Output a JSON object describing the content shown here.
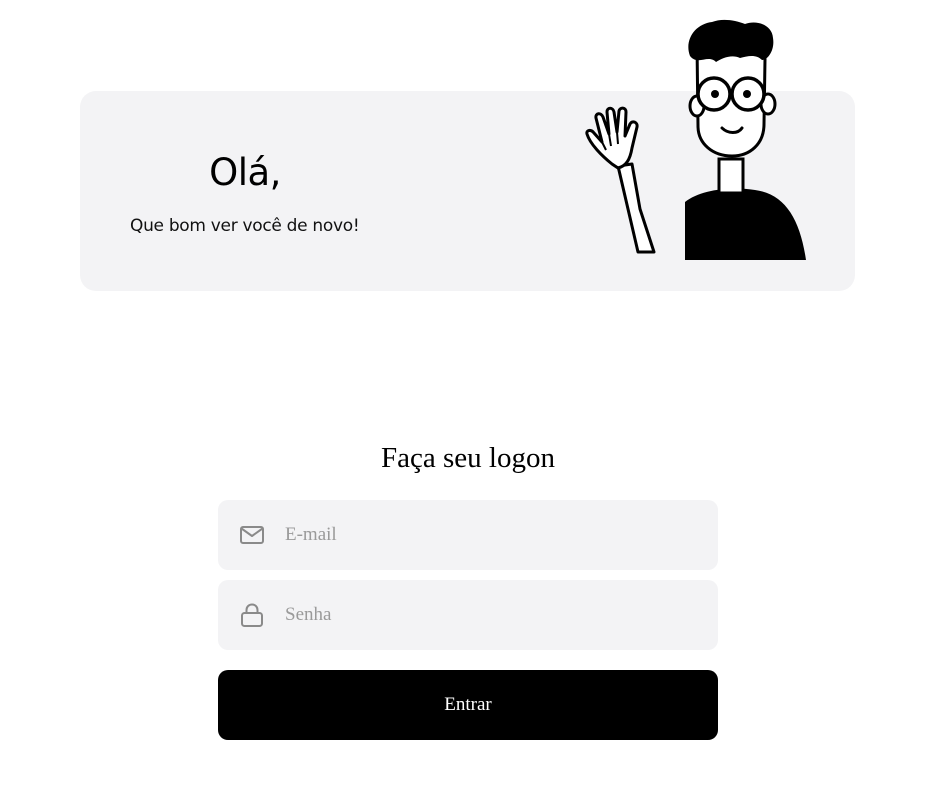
{
  "hero": {
    "greeting": "Olá,",
    "subtitle": "Que bom ver você de novo!",
    "illustration": "waving-person-illustration"
  },
  "form": {
    "title": "Faça seu logon",
    "email": {
      "icon": "mail-icon",
      "placeholder": "E-mail",
      "value": ""
    },
    "password": {
      "icon": "lock-icon",
      "placeholder": "Senha",
      "value": ""
    },
    "submit_label": "Entrar"
  },
  "colors": {
    "card_background": "#f3f3f5",
    "button_background": "#000000",
    "button_text": "#ffffff",
    "placeholder": "#9a9a9a",
    "icon": "#8a8a8a"
  }
}
